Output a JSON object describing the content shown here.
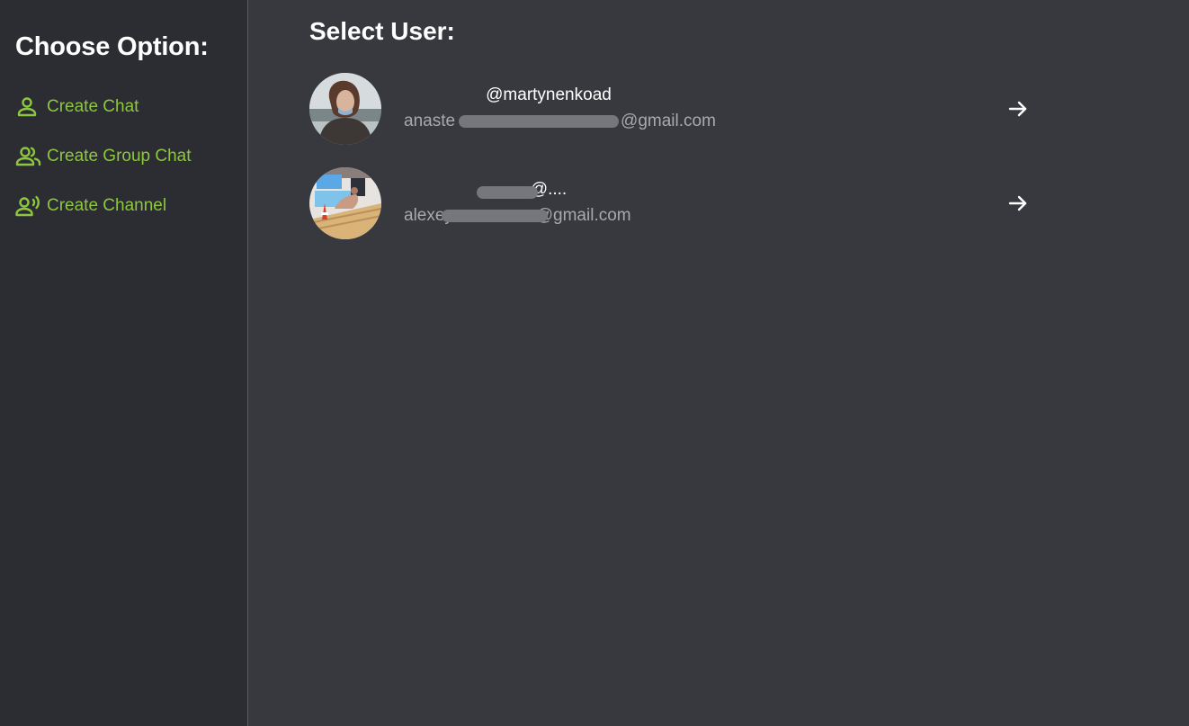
{
  "sidebar": {
    "title": "Choose Option:",
    "items": [
      {
        "label": "Create Chat",
        "icon": "person-icon"
      },
      {
        "label": "Create Group Chat",
        "icon": "group-icon"
      },
      {
        "label": "Create Channel",
        "icon": "broadcast-person-icon"
      }
    ]
  },
  "main": {
    "title": "Select User:",
    "users": [
      {
        "username": "@martynenkoad",
        "email": "anastasia.......@gmail.com",
        "email_visible_prefix": "anaste",
        "email_visible_suffix": "@gmail.com"
      },
      {
        "username": "@....",
        "email": "alexeym.......@gmail.com",
        "email_visible_prefix": "alexeym",
        "email_visible_suffix": "@gmail.com"
      }
    ]
  },
  "colors": {
    "accent": "#8dc63f",
    "sidebar_bg": "#2c2d32",
    "main_bg": "#38393f",
    "text_primary": "#ffffff",
    "text_secondary": "#a8a9ad"
  }
}
